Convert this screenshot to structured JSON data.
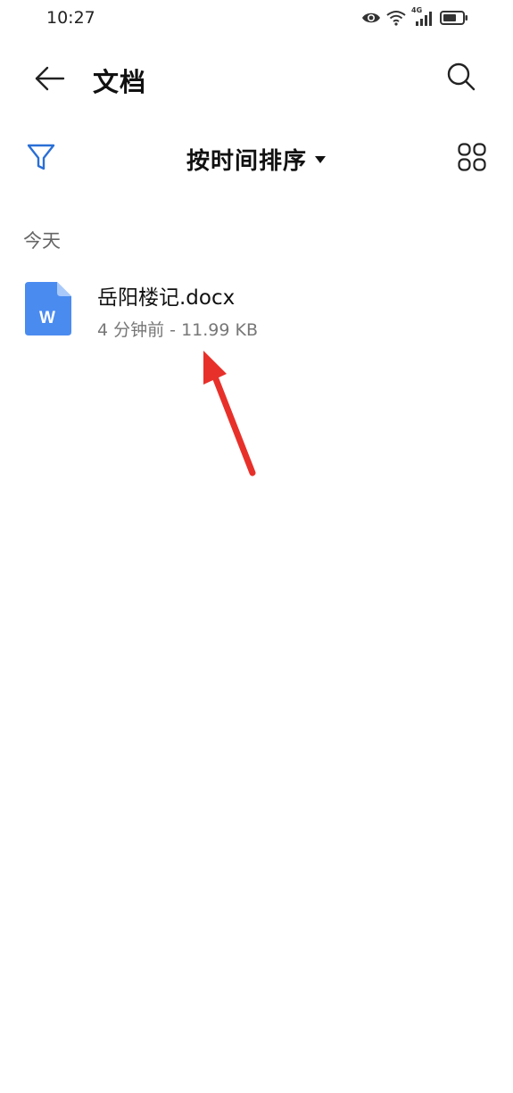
{
  "status_bar": {
    "time": "10:27",
    "icons": [
      "eye-icon",
      "wifi-icon",
      "signal-4g-icon",
      "battery-icon"
    ],
    "network_label": "4G"
  },
  "header": {
    "title": "文档",
    "back_icon": "arrow-left-icon",
    "search_icon": "search-icon"
  },
  "toolbar": {
    "filter_icon": "filter-icon",
    "sort_label": "按时间排序",
    "sort_dropdown_icon": "caret-down-icon",
    "grid_icon": "grid-view-icon"
  },
  "sections": [
    {
      "header": "今天",
      "files": [
        {
          "name": "岳阳楼记.docx",
          "meta": "4 分钟前 - 11.99 KB",
          "icon": "word-document-icon",
          "icon_letter": "W"
        }
      ]
    }
  ],
  "colors": {
    "accent": "#2a6fd6",
    "word_icon": "#4a8bf0",
    "annotation_arrow": "#e8302a"
  }
}
